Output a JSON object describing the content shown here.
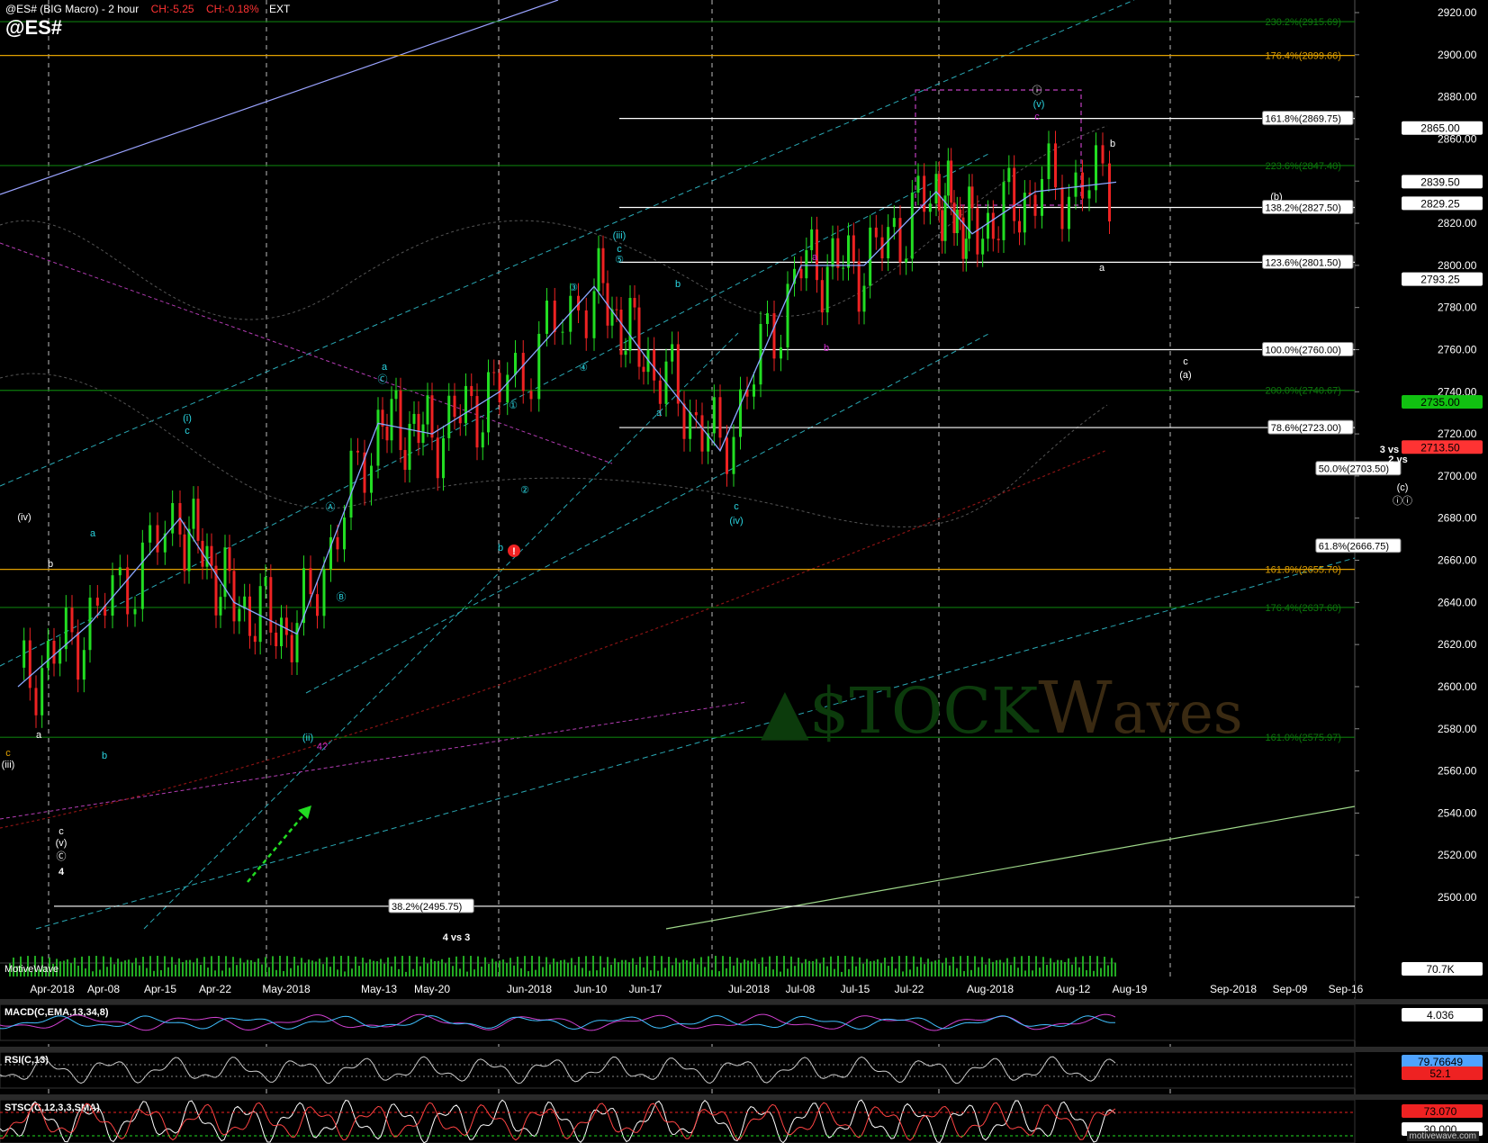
{
  "header": {
    "title": "@ES# (BIG Macro) - 2 hour",
    "change_abs": "CH:-5.25",
    "change_pct": "CH:-0.18%",
    "session": "EXT",
    "symbol": "@ES#"
  },
  "price_axis": {
    "labels": [
      "2920.00",
      "2900.00",
      "2880.00",
      "2860.00",
      "2840.00",
      "2820.00",
      "2800.00",
      "2780.00",
      "2760.00",
      "2740.00",
      "2720.00",
      "2700.00",
      "2680.00",
      "2660.00",
      "2640.00",
      "2620.00",
      "2600.00",
      "2580.00",
      "2560.00",
      "2540.00",
      "2520.00",
      "2500.00"
    ],
    "badges": [
      {
        "text": "2865.00",
        "color": "#ffffff"
      },
      {
        "text": "2839.50",
        "color": "#ffffff"
      },
      {
        "text": "2829.25",
        "color": "#ffffff"
      },
      {
        "text": "2793.25",
        "color": "#ffffff"
      },
      {
        "text": "2735.00",
        "color": "#11c111"
      },
      {
        "text": "2713.50",
        "color": "#ff3333"
      },
      {
        "text": "70.7K",
        "color": "#ffffff"
      }
    ]
  },
  "time_axis": {
    "labels": [
      "Apr-2018",
      "Apr-08",
      "Apr-15",
      "Apr-22",
      "May-2018",
      "May-13",
      "May-20",
      "Jun-2018",
      "Jun-10",
      "Jun-17",
      "Jul-2018",
      "Jul-08",
      "Jul-15",
      "Jul-22",
      "Aug-2018",
      "Aug-12",
      "Aug-19",
      "Sep-2018",
      "Sep-09",
      "Sep-16"
    ]
  },
  "fib_levels": [
    {
      "label": "230.2%(2915.69)",
      "color": "#0c7a0c"
    },
    {
      "label": "176.4%(2899.66)",
      "color": "#e0a000"
    },
    {
      "label": "161.8%(2869.75)",
      "color": "#ffffff"
    },
    {
      "label": "223.6%(2847.40)",
      "color": "#0c7a0c"
    },
    {
      "label": "138.2%(2827.50)",
      "color": "#ffffff"
    },
    {
      "label": "123.6%(2801.50)",
      "color": "#ffffff"
    },
    {
      "label": "100.0%(2760.00)",
      "color": "#ffffff"
    },
    {
      "label": "200.0%(2740.67)",
      "color": "#0c7a0c"
    },
    {
      "label": "78.6%(2723.00)",
      "color": "#ffffff"
    },
    {
      "label": "50.0%(2703.50)",
      "color": "#ffffff"
    },
    {
      "label": "61.8%(2666.75)",
      "color": "#ffffff"
    },
    {
      "label": "161.8%(2655.70)",
      "color": "#e0a000"
    },
    {
      "label": "176.4%(2637.60)",
      "color": "#0c7a0c"
    },
    {
      "label": "161.0%(2575.97)",
      "color": "#0c7a0c"
    },
    {
      "label": "38.2%(2495.75)",
      "color": "#ffffff"
    }
  ],
  "wave_labels": [
    "(iv)",
    "b",
    "c",
    "(iii)",
    "a",
    "c",
    "(v)",
    "Ⓒ",
    "4",
    "a",
    "b",
    "(i)",
    "c",
    "(ii)",
    "4?",
    "Ⓐ",
    "Ⓑ",
    "a",
    "Ⓒ",
    "①",
    "②",
    "③",
    "④",
    "⑤",
    "(iii)",
    "c",
    "b",
    "a",
    "b",
    "c",
    "(iv)",
    "a",
    "b",
    "ⓘ",
    "(v)",
    "c",
    "b",
    "a",
    "(b)",
    "c",
    "(a)",
    "3 vs 1",
    "2 vs",
    "(c)",
    "ⓘⓘ",
    "4 vs 3"
  ],
  "watermark": {
    "part1": "▲$TOCK",
    "part2": "W",
    "part3": "aves"
  },
  "indicators": {
    "volume": {
      "label": "MotiveWave"
    },
    "macd": {
      "label": "MACD(C,EMA,13,34,8)",
      "value": "4.036"
    },
    "rsi": {
      "label": "RSI(C,13)",
      "value_high": "79.76649",
      "value_low": "52.1"
    },
    "stoch": {
      "label": "STSC(C,12,3,3,SMA)",
      "value_high": "73.070",
      "value_low": "30.000"
    }
  },
  "footer": "motivewave.com",
  "chart_data": {
    "type": "line",
    "title": "@ES# (BIG Macro) - 2 hour",
    "ylim": [
      2490,
      2925
    ],
    "x": [
      "Apr-2018",
      "Apr-08",
      "Apr-15",
      "Apr-22",
      "May-2018",
      "May-13",
      "May-20",
      "Jun-2018",
      "Jun-10",
      "Jun-17",
      "Jul-2018",
      "Jul-08",
      "Jul-15",
      "Jul-22",
      "Aug-2018",
      "Aug-12",
      "Aug-19"
    ],
    "series": [
      {
        "values": [
          2600,
          2630,
          2680,
          2640,
          2625,
          2725,
          2720,
          2740,
          2790,
          2755,
          2712,
          2800,
          2800,
          2835,
          2815,
          2835,
          2839.5
        ]
      }
    ],
    "grid": false
  }
}
